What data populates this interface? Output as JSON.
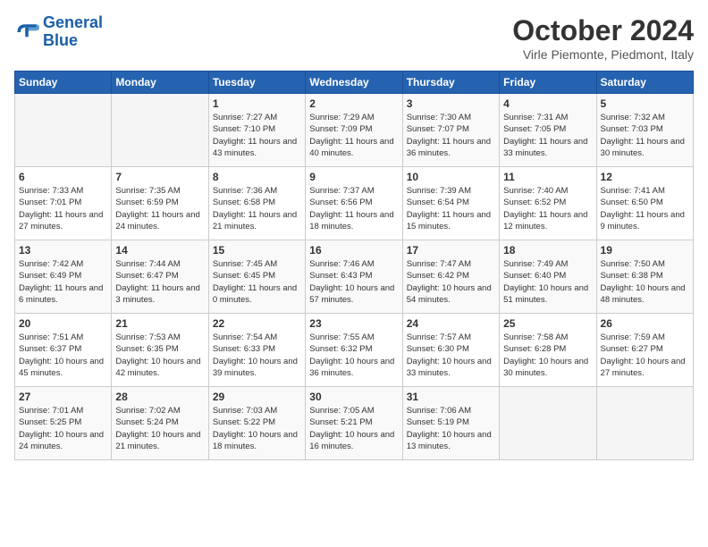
{
  "header": {
    "logo_general": "General",
    "logo_blue": "Blue",
    "title": "October 2024",
    "location": "Virle Piemonte, Piedmont, Italy"
  },
  "weekdays": [
    "Sunday",
    "Monday",
    "Tuesday",
    "Wednesday",
    "Thursday",
    "Friday",
    "Saturday"
  ],
  "weeks": [
    [
      {
        "day": "",
        "info": ""
      },
      {
        "day": "",
        "info": ""
      },
      {
        "day": "1",
        "info": "Sunrise: 7:27 AM\nSunset: 7:10 PM\nDaylight: 11 hours and 43 minutes."
      },
      {
        "day": "2",
        "info": "Sunrise: 7:29 AM\nSunset: 7:09 PM\nDaylight: 11 hours and 40 minutes."
      },
      {
        "day": "3",
        "info": "Sunrise: 7:30 AM\nSunset: 7:07 PM\nDaylight: 11 hours and 36 minutes."
      },
      {
        "day": "4",
        "info": "Sunrise: 7:31 AM\nSunset: 7:05 PM\nDaylight: 11 hours and 33 minutes."
      },
      {
        "day": "5",
        "info": "Sunrise: 7:32 AM\nSunset: 7:03 PM\nDaylight: 11 hours and 30 minutes."
      }
    ],
    [
      {
        "day": "6",
        "info": "Sunrise: 7:33 AM\nSunset: 7:01 PM\nDaylight: 11 hours and 27 minutes."
      },
      {
        "day": "7",
        "info": "Sunrise: 7:35 AM\nSunset: 6:59 PM\nDaylight: 11 hours and 24 minutes."
      },
      {
        "day": "8",
        "info": "Sunrise: 7:36 AM\nSunset: 6:58 PM\nDaylight: 11 hours and 21 minutes."
      },
      {
        "day": "9",
        "info": "Sunrise: 7:37 AM\nSunset: 6:56 PM\nDaylight: 11 hours and 18 minutes."
      },
      {
        "day": "10",
        "info": "Sunrise: 7:39 AM\nSunset: 6:54 PM\nDaylight: 11 hours and 15 minutes."
      },
      {
        "day": "11",
        "info": "Sunrise: 7:40 AM\nSunset: 6:52 PM\nDaylight: 11 hours and 12 minutes."
      },
      {
        "day": "12",
        "info": "Sunrise: 7:41 AM\nSunset: 6:50 PM\nDaylight: 11 hours and 9 minutes."
      }
    ],
    [
      {
        "day": "13",
        "info": "Sunrise: 7:42 AM\nSunset: 6:49 PM\nDaylight: 11 hours and 6 minutes."
      },
      {
        "day": "14",
        "info": "Sunrise: 7:44 AM\nSunset: 6:47 PM\nDaylight: 11 hours and 3 minutes."
      },
      {
        "day": "15",
        "info": "Sunrise: 7:45 AM\nSunset: 6:45 PM\nDaylight: 11 hours and 0 minutes."
      },
      {
        "day": "16",
        "info": "Sunrise: 7:46 AM\nSunset: 6:43 PM\nDaylight: 10 hours and 57 minutes."
      },
      {
        "day": "17",
        "info": "Sunrise: 7:47 AM\nSunset: 6:42 PM\nDaylight: 10 hours and 54 minutes."
      },
      {
        "day": "18",
        "info": "Sunrise: 7:49 AM\nSunset: 6:40 PM\nDaylight: 10 hours and 51 minutes."
      },
      {
        "day": "19",
        "info": "Sunrise: 7:50 AM\nSunset: 6:38 PM\nDaylight: 10 hours and 48 minutes."
      }
    ],
    [
      {
        "day": "20",
        "info": "Sunrise: 7:51 AM\nSunset: 6:37 PM\nDaylight: 10 hours and 45 minutes."
      },
      {
        "day": "21",
        "info": "Sunrise: 7:53 AM\nSunset: 6:35 PM\nDaylight: 10 hours and 42 minutes."
      },
      {
        "day": "22",
        "info": "Sunrise: 7:54 AM\nSunset: 6:33 PM\nDaylight: 10 hours and 39 minutes."
      },
      {
        "day": "23",
        "info": "Sunrise: 7:55 AM\nSunset: 6:32 PM\nDaylight: 10 hours and 36 minutes."
      },
      {
        "day": "24",
        "info": "Sunrise: 7:57 AM\nSunset: 6:30 PM\nDaylight: 10 hours and 33 minutes."
      },
      {
        "day": "25",
        "info": "Sunrise: 7:58 AM\nSunset: 6:28 PM\nDaylight: 10 hours and 30 minutes."
      },
      {
        "day": "26",
        "info": "Sunrise: 7:59 AM\nSunset: 6:27 PM\nDaylight: 10 hours and 27 minutes."
      }
    ],
    [
      {
        "day": "27",
        "info": "Sunrise: 7:01 AM\nSunset: 5:25 PM\nDaylight: 10 hours and 24 minutes."
      },
      {
        "day": "28",
        "info": "Sunrise: 7:02 AM\nSunset: 5:24 PM\nDaylight: 10 hours and 21 minutes."
      },
      {
        "day": "29",
        "info": "Sunrise: 7:03 AM\nSunset: 5:22 PM\nDaylight: 10 hours and 18 minutes."
      },
      {
        "day": "30",
        "info": "Sunrise: 7:05 AM\nSunset: 5:21 PM\nDaylight: 10 hours and 16 minutes."
      },
      {
        "day": "31",
        "info": "Sunrise: 7:06 AM\nSunset: 5:19 PM\nDaylight: 10 hours and 13 minutes."
      },
      {
        "day": "",
        "info": ""
      },
      {
        "day": "",
        "info": ""
      }
    ]
  ]
}
